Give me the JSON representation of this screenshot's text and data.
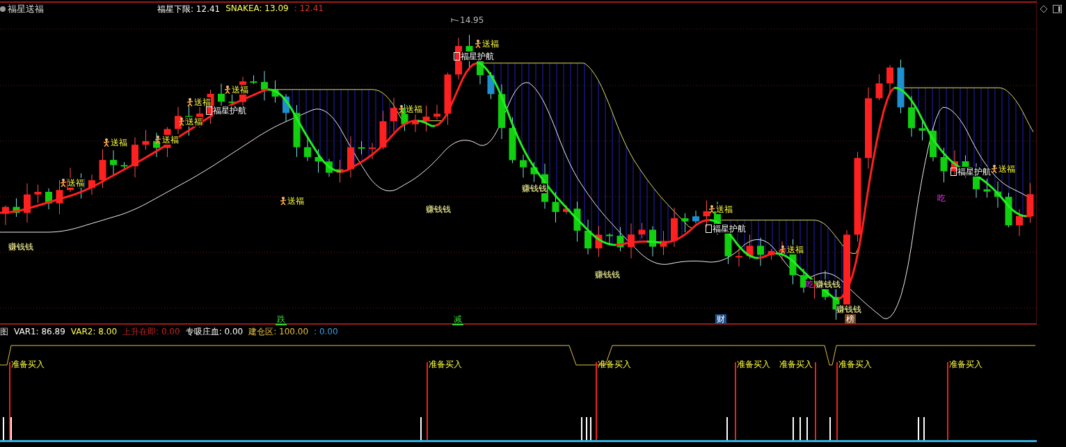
{
  "title": "福星送福",
  "header_values": [
    {
      "text": "福星下限: 12.41",
      "color": "#ffffff"
    },
    {
      "text": "SNAKEA: 13.09",
      "color": "#ffff55"
    },
    {
      "text": ": 12.41",
      "color": "#e03030"
    }
  ],
  "markers": [
    {
      "kind": "gift",
      "text": "送福"
    },
    {
      "kind": "gift",
      "text": "送福"
    },
    {
      "kind": "gift",
      "text": "送福"
    },
    {
      "kind": "gift",
      "text": "送福"
    },
    {
      "kind": "gift",
      "text": "送福"
    },
    {
      "kind": "escort",
      "text": "福星护航"
    },
    {
      "kind": "gift",
      "text": "送福"
    },
    {
      "kind": "gift",
      "text": "送福"
    },
    {
      "kind": "price",
      "text": "14.95"
    },
    {
      "kind": "escort",
      "text": "福星护航"
    },
    {
      "kind": "gift",
      "text": "送福"
    },
    {
      "kind": "gift",
      "text": "送福"
    },
    {
      "kind": "escort",
      "text": "福星护航"
    },
    {
      "kind": "gift",
      "text": "送福"
    },
    {
      "kind": "gift",
      "text": "送福"
    },
    {
      "kind": "escort",
      "text": "福星护航"
    },
    {
      "kind": "gift",
      "text": "送福"
    },
    {
      "kind": "eat",
      "text": "吃"
    },
    {
      "kind": "eat",
      "text": "吃"
    },
    {
      "kind": "earn",
      "text": "赚钱钱"
    },
    {
      "kind": "earn",
      "text": "赚钱钱"
    },
    {
      "kind": "earn",
      "text": "赚钱钱"
    },
    {
      "kind": "earn",
      "text": "赚钱钱"
    },
    {
      "kind": "earn",
      "text": "赚钱钱"
    },
    {
      "kind": "earn",
      "text": "赚钱钱"
    }
  ],
  "event_tags": [
    {
      "kind": "plain",
      "text": "跌",
      "color": "#33dd33"
    },
    {
      "kind": "plain",
      "text": "减",
      "color": "#33dd33"
    },
    {
      "kind": "filled",
      "text": "财",
      "color": "#1d4f8a"
    },
    {
      "kind": "filled",
      "text": "榜",
      "color": "#7a4620"
    }
  ],
  "indicator_legend": [
    {
      "text": "图"
    },
    {
      "text": "VAR1: 86.89",
      "color": "#ffffff"
    },
    {
      "text": "VAR2: 8.00",
      "color": "#ffff55"
    },
    {
      "text": "上升在即: 0.00",
      "color": "#cc2222"
    },
    {
      "text": "专吸庄血: 0.00",
      "color": "#ffffff"
    },
    {
      "text": "建仓区: 100.00",
      "color": "#e8c040"
    },
    {
      "text": ": 0.00",
      "color": "#3aa0e0"
    }
  ],
  "buy_signals": [
    {
      "text": "准备买入"
    },
    {
      "text": "准备买入"
    },
    {
      "text": "准备买入"
    },
    {
      "text": "准备买入"
    },
    {
      "text": "准备买入"
    },
    {
      "text": "准备买入"
    },
    {
      "text": "准备买入"
    }
  ]
}
